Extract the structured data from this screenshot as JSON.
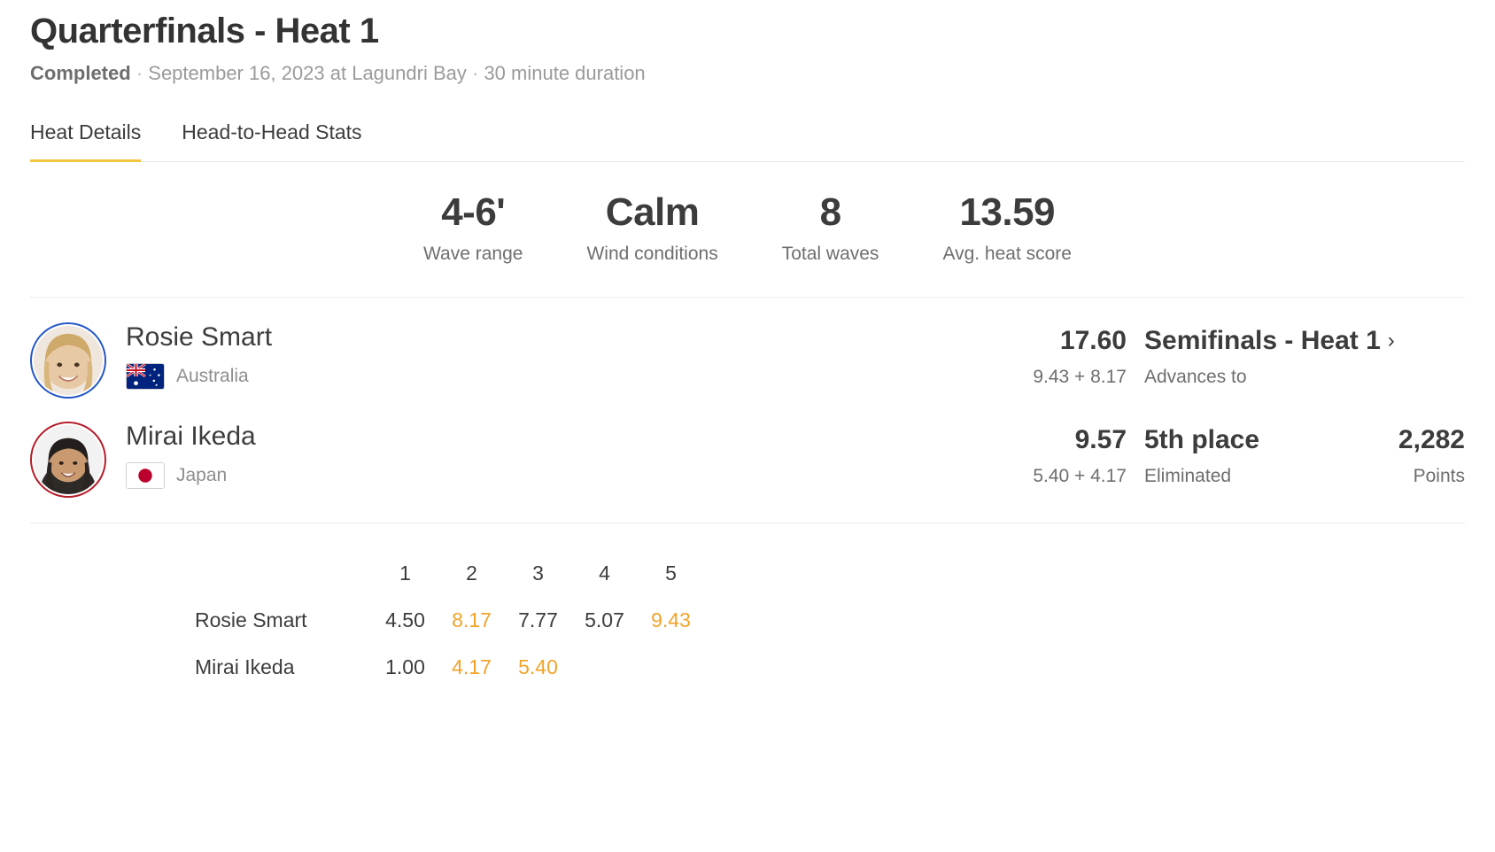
{
  "header": {
    "title": "Quarterfinals - Heat 1",
    "status": "Completed",
    "sep1": "·",
    "date_location": "September 16, 2023 at Lagundri Bay",
    "sep2": "·",
    "duration": "30 minute duration"
  },
  "tabs": [
    {
      "label": "Heat Details",
      "active": true
    },
    {
      "label": "Head-to-Head Stats",
      "active": false
    }
  ],
  "stats": [
    {
      "value": "4-6'",
      "label": "Wave range"
    },
    {
      "value": "Calm",
      "label": "Wind conditions"
    },
    {
      "value": "8",
      "label": "Total waves"
    },
    {
      "value": "13.59",
      "label": "Avg. heat score"
    }
  ],
  "athletes": [
    {
      "name": "Rosie Smart",
      "country": "Australia",
      "flag": "australia-flag",
      "ring": "#2457c5",
      "total": "17.60",
      "breakdown": "9.43 + 8.17",
      "status": "Semifinals - Heat 1",
      "status_sub": "Advances to",
      "has_chevron": true,
      "points": "",
      "points_label": ""
    },
    {
      "name": "Mirai Ikeda",
      "country": "Japan",
      "flag": "japan-flag",
      "ring": "#b51b28",
      "total": "9.57",
      "breakdown": "5.40 + 4.17",
      "status": "5th place",
      "status_sub": "Eliminated",
      "has_chevron": false,
      "points": "2,282",
      "points_label": "Points"
    }
  ],
  "wave_table": {
    "columns": [
      "1",
      "2",
      "3",
      "4",
      "5"
    ],
    "rows": [
      {
        "name": "Rosie Smart",
        "scores": [
          {
            "value": "4.50",
            "highlight": false
          },
          {
            "value": "8.17",
            "highlight": true
          },
          {
            "value": "7.77",
            "highlight": false
          },
          {
            "value": "5.07",
            "highlight": false
          },
          {
            "value": "9.43",
            "highlight": true
          }
        ]
      },
      {
        "name": "Mirai Ikeda",
        "scores": [
          {
            "value": "1.00",
            "highlight": false
          },
          {
            "value": "4.17",
            "highlight": true
          },
          {
            "value": "5.40",
            "highlight": true
          },
          {
            "value": "",
            "highlight": false
          },
          {
            "value": "",
            "highlight": false
          }
        ]
      }
    ]
  },
  "colors": {
    "accent": "#f3c342",
    "highlight": "#f0a32a",
    "rank1_ring": "#2457c5",
    "rank2_ring": "#b51b28"
  }
}
